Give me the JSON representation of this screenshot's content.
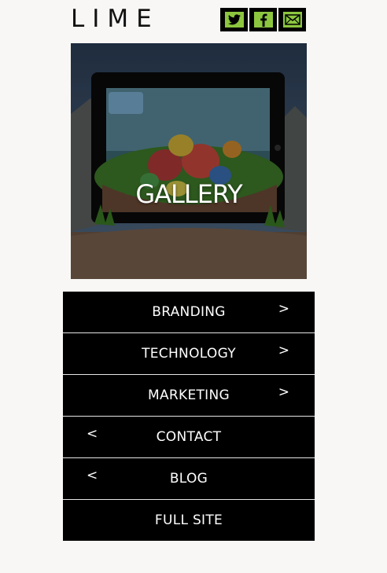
{
  "header": {
    "logo_text": "LIME",
    "social": [
      {
        "name": "twitter-icon",
        "color": "#8cc63f"
      },
      {
        "name": "facebook-icon",
        "color": "#8cc63f"
      },
      {
        "name": "mail-icon",
        "color": "#8cc63f"
      }
    ]
  },
  "hero": {
    "title": "GALLERY"
  },
  "nav": {
    "items": [
      {
        "label": "BRANDING",
        "arrow": ">"
      },
      {
        "label": "TECHNOLOGY",
        "arrow": ">"
      },
      {
        "label": "MARKETING",
        "arrow": ">"
      },
      {
        "label": "CONTACT",
        "arrow": "<"
      },
      {
        "label": "BLOG",
        "arrow": "<"
      },
      {
        "label": "FULL SITE",
        "arrow": ""
      }
    ]
  },
  "colors": {
    "background": "#f8f7f5",
    "nav_bg": "#000000",
    "accent": "#8cc63f"
  }
}
